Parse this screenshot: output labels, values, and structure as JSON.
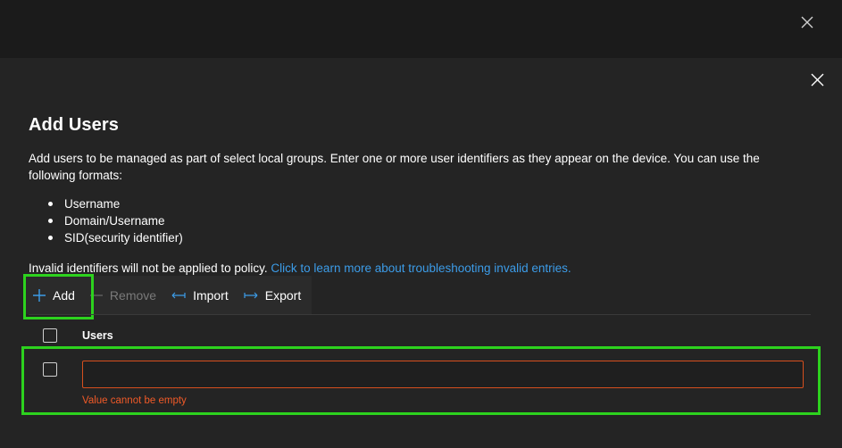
{
  "dialog": {
    "title": "Add Users",
    "description": "Add users to be managed as part of select local groups. Enter one or more user identifiers as they appear on the device. You can use the following formats:",
    "formats": [
      "Username",
      "Domain/Username",
      "SID(security identifier)"
    ],
    "invalid_note": "Invalid identifiers will not be applied to policy.",
    "invalid_link": "Click to learn more about troubleshooting invalid entries."
  },
  "toolbar": {
    "add_label": "Add",
    "remove_label": "Remove",
    "import_label": "Import",
    "export_label": "Export"
  },
  "table": {
    "column_users": "Users",
    "rows": [
      {
        "value": "",
        "error": "Value cannot be empty"
      }
    ]
  },
  "icons": {
    "close": "close-icon",
    "add": "plus-icon",
    "remove": "minus-icon",
    "import": "import-icon",
    "export": "export-icon"
  },
  "colors": {
    "accent_link": "#3c9ce8",
    "error": "#f05a28",
    "error_border": "#d64f1e",
    "highlight": "#2dd21e"
  }
}
